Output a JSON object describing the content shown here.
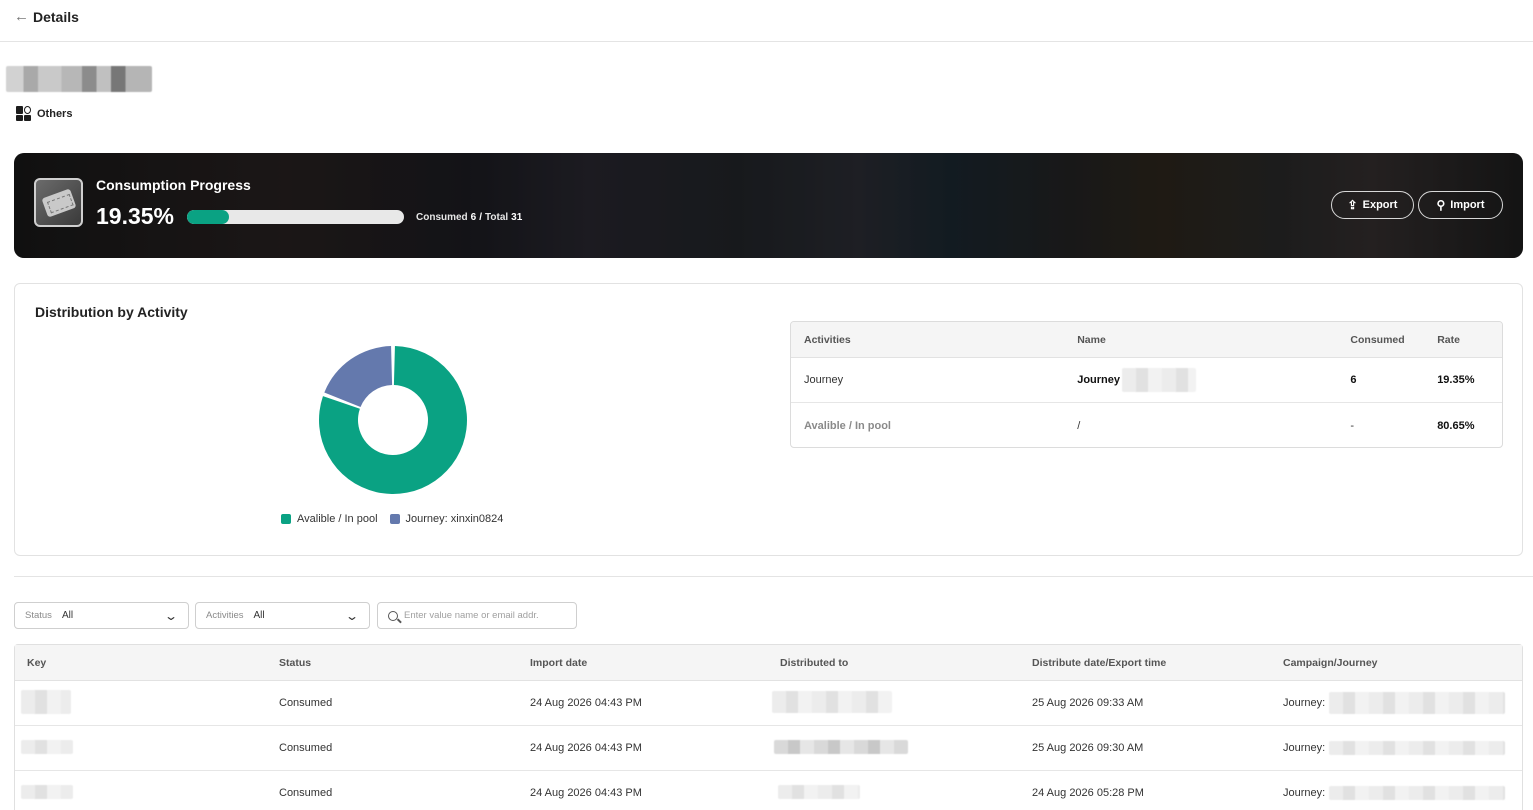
{
  "header": {
    "back_icon": "arrow-left-icon",
    "title": "Details"
  },
  "item": {
    "category_icon": "grid-shapes-icon",
    "category": "Others"
  },
  "progress": {
    "title": "Consumption Progress",
    "percent_label": "19.35%",
    "fraction": 0.1935,
    "consumed_label": "Consumed",
    "consumed": "6",
    "separator": "/",
    "total_label": "Total",
    "total": "31",
    "export_label": "Export",
    "import_label": "Import",
    "accent": "#0aa283"
  },
  "distribution": {
    "title": "Distribution by Activity",
    "columns": [
      "Activities",
      "Name",
      "Consumed",
      "Rate"
    ],
    "rows": [
      {
        "activity": "Journey",
        "name": "Journey",
        "consumed": "6",
        "rate": "19.35%"
      },
      {
        "activity": "Avalible / In pool",
        "name": "/",
        "consumed": "-",
        "rate": "80.65%"
      }
    ]
  },
  "chart_data": {
    "type": "pie",
    "donut": true,
    "categories": [
      "Avalible / In pool",
      "Journey: xinxin0824"
    ],
    "values": [
      80.65,
      19.35
    ],
    "colors": [
      "#0aa283",
      "#6479ad"
    ],
    "legend": "bottom"
  },
  "filters": {
    "status_label": "Status",
    "status_value": "All",
    "activities_label": "Activities",
    "activities_value": "All",
    "search_placeholder": "Enter value name or email addr."
  },
  "keys_table": {
    "columns": [
      "Key",
      "Status",
      "Import date",
      "Distributed to",
      "Distribute date/Export time",
      "Campaign/Journey"
    ],
    "rows": [
      {
        "status": "Consumed",
        "import_date": "24 Aug 2026 04:43 PM",
        "distribute_date": "25 Aug 2026 09:33 AM",
        "campaign_prefix": "Journey:"
      },
      {
        "status": "Consumed",
        "import_date": "24 Aug 2026 04:43 PM",
        "distribute_date": "25 Aug 2026 09:30 AM",
        "campaign_prefix": "Journey:"
      },
      {
        "status": "Consumed",
        "import_date": "24 Aug 2026 04:43 PM",
        "distribute_date": "24 Aug 2026 05:28 PM",
        "campaign_prefix": "Journey:"
      }
    ]
  }
}
